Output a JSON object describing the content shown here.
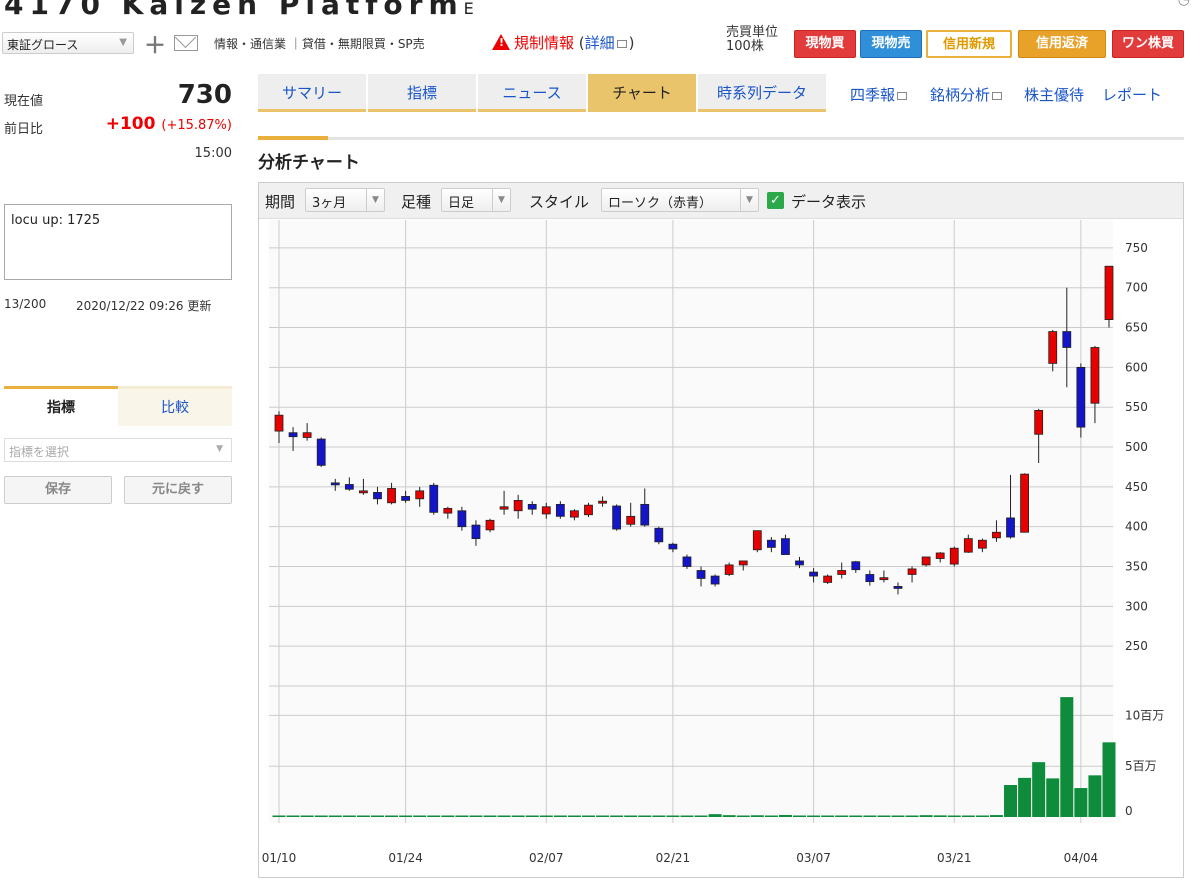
{
  "header": {
    "title": "4170 Kaizen Platform",
    "title_suffix": "E",
    "market": "東証グロース",
    "info": "情報・通信業 ｜貸借・無期限買・SP売",
    "regulation": "規制情報",
    "regulation_detail": "詳細",
    "unit_label": "売買単位",
    "unit_value": "100株",
    "buttons": [
      "現物買",
      "現物売",
      "信用新規",
      "信用返済",
      "ワン株買"
    ]
  },
  "quote": {
    "current_label": "現在値",
    "current_value": "730",
    "diff_label": "前日比",
    "diff_value": "+100",
    "diff_pct": "+15.87%",
    "time": "15:00"
  },
  "memo": {
    "text": "locu up: 1725",
    "count": "13/200",
    "updated": "2020/12/22 09:26 更新"
  },
  "indicator_panel": {
    "tabs": [
      "指標",
      "比較"
    ],
    "select_placeholder": "指標を選択",
    "save": "保存",
    "reset": "元に戻す"
  },
  "tabs": [
    "サマリー",
    "指標",
    "ニュース",
    "チャート",
    "時系列データ"
  ],
  "active_tab": "チャート",
  "link_tabs": [
    "四季報",
    "銘柄分析",
    "株主優待",
    "レポート"
  ],
  "section_title": "分析チャート",
  "toolbar": {
    "period_label": "期間",
    "period_value": "3ヶ月",
    "bar_label": "足種",
    "bar_value": "日足",
    "style_label": "スタイル",
    "style_value": "ローソク（赤青）",
    "data_display": "データ表示"
  },
  "colors": {
    "up": "#e60000",
    "down": "#1414c8",
    "volume": "#0e8c3c",
    "accent": "#e9b13b"
  },
  "chart_data": {
    "type": "candlestick",
    "y_ticks": [
      250,
      300,
      350,
      400,
      450,
      500,
      550,
      600,
      650,
      700,
      750
    ],
    "y_range": [
      205,
      775
    ],
    "volume_ticks": [
      {
        "v": 0,
        "label": "0"
      },
      {
        "v": 5,
        "label": "5百万"
      },
      {
        "v": 10,
        "label": "10百万"
      }
    ],
    "volume_unit": "百万",
    "volume_range": [
      0,
      12.5
    ],
    "x_tick_labels": [
      {
        "index": 0,
        "label": "01/10"
      },
      {
        "index": 9,
        "label": "01/24"
      },
      {
        "index": 19,
        "label": "02/07"
      },
      {
        "index": 28,
        "label": "02/21"
      },
      {
        "index": 38,
        "label": "03/07"
      },
      {
        "index": 48,
        "label": "03/21"
      },
      {
        "index": 57,
        "label": "04/04"
      }
    ],
    "candles": [
      {
        "o": 520,
        "h": 545,
        "l": 505,
        "c": 540,
        "v": 0.05
      },
      {
        "o": 518,
        "h": 525,
        "l": 495,
        "c": 513,
        "v": 0.05
      },
      {
        "o": 512,
        "h": 530,
        "l": 508,
        "c": 518,
        "v": 0.12
      },
      {
        "o": 510,
        "h": 512,
        "l": 475,
        "c": 477,
        "v": 0.06
      },
      {
        "o": 455,
        "h": 460,
        "l": 445,
        "c": 453,
        "v": 0.05
      },
      {
        "o": 453,
        "h": 462,
        "l": 445,
        "c": 447,
        "v": 0.04
      },
      {
        "o": 445,
        "h": 460,
        "l": 440,
        "c": 445,
        "v": 0.03
      },
      {
        "o": 443,
        "h": 450,
        "l": 428,
        "c": 435,
        "v": 0.03
      },
      {
        "o": 430,
        "h": 455,
        "l": 428,
        "c": 448,
        "v": 0.03
      },
      {
        "o": 438,
        "h": 445,
        "l": 430,
        "c": 433,
        "v": 0.03
      },
      {
        "o": 435,
        "h": 450,
        "l": 425,
        "c": 445,
        "v": 0.04
      },
      {
        "o": 452,
        "h": 455,
        "l": 415,
        "c": 418,
        "v": 0.03
      },
      {
        "o": 417,
        "h": 425,
        "l": 410,
        "c": 423,
        "v": 0.04
      },
      {
        "o": 420,
        "h": 425,
        "l": 395,
        "c": 400,
        "v": 0.03
      },
      {
        "o": 402,
        "h": 408,
        "l": 376,
        "c": 385,
        "v": 0.03
      },
      {
        "o": 396,
        "h": 410,
        "l": 393,
        "c": 408,
        "v": 0.03
      },
      {
        "o": 422,
        "h": 445,
        "l": 415,
        "c": 425,
        "v": 0.03
      },
      {
        "o": 420,
        "h": 440,
        "l": 410,
        "c": 433,
        "v": 0.04
      },
      {
        "o": 428,
        "h": 432,
        "l": 415,
        "c": 422,
        "v": 0.03
      },
      {
        "o": 416,
        "h": 430,
        "l": 410,
        "c": 425,
        "v": 0.03
      },
      {
        "o": 428,
        "h": 432,
        "l": 410,
        "c": 413,
        "v": 0.03
      },
      {
        "o": 412,
        "h": 422,
        "l": 408,
        "c": 420,
        "v": 0.04
      },
      {
        "o": 415,
        "h": 430,
        "l": 412,
        "c": 427,
        "v": 0.05
      },
      {
        "o": 430,
        "h": 438,
        "l": 425,
        "c": 432,
        "v": 0.04
      },
      {
        "o": 426,
        "h": 428,
        "l": 395,
        "c": 397,
        "v": 0.13
      },
      {
        "o": 403,
        "h": 430,
        "l": 400,
        "c": 413,
        "v": 0.05
      },
      {
        "o": 428,
        "h": 448,
        "l": 400,
        "c": 402,
        "v": 0.08
      },
      {
        "o": 398,
        "h": 400,
        "l": 378,
        "c": 381,
        "v": 0.07
      },
      {
        "o": 378,
        "h": 380,
        "l": 368,
        "c": 372,
        "v": 0.1
      },
      {
        "o": 362,
        "h": 365,
        "l": 347,
        "c": 350,
        "v": 0.08
      },
      {
        "o": 345,
        "h": 350,
        "l": 325,
        "c": 335,
        "v": 0.07
      },
      {
        "o": 338,
        "h": 340,
        "l": 325,
        "c": 328,
        "v": 0.28
      },
      {
        "o": 340,
        "h": 355,
        "l": 338,
        "c": 352,
        "v": 0.18
      },
      {
        "o": 352,
        "h": 357,
        "l": 345,
        "c": 357,
        "v": 0.12
      },
      {
        "o": 371,
        "h": 395,
        "l": 368,
        "c": 395,
        "v": 0.17
      },
      {
        "o": 383,
        "h": 387,
        "l": 368,
        "c": 374,
        "v": 0.12
      },
      {
        "o": 385,
        "h": 390,
        "l": 365,
        "c": 365,
        "v": 0.2
      },
      {
        "o": 357,
        "h": 362,
        "l": 348,
        "c": 352,
        "v": 0.07
      },
      {
        "o": 343,
        "h": 348,
        "l": 330,
        "c": 338,
        "v": 0.06
      },
      {
        "o": 330,
        "h": 340,
        "l": 328,
        "c": 338,
        "v": 0.06
      },
      {
        "o": 340,
        "h": 355,
        "l": 335,
        "c": 345,
        "v": 0.05
      },
      {
        "o": 356,
        "h": 357,
        "l": 342,
        "c": 346,
        "v": 0.04
      },
      {
        "o": 340,
        "h": 345,
        "l": 326,
        "c": 331,
        "v": 0.05
      },
      {
        "o": 335,
        "h": 345,
        "l": 330,
        "c": 336,
        "v": 0.03
      },
      {
        "o": 325,
        "h": 330,
        "l": 315,
        "c": 323,
        "v": 0.04
      },
      {
        "o": 340,
        "h": 350,
        "l": 330,
        "c": 347,
        "v": 0.05
      },
      {
        "o": 352,
        "h": 362,
        "l": 350,
        "c": 362,
        "v": 0.18
      },
      {
        "o": 360,
        "h": 368,
        "l": 355,
        "c": 367,
        "v": 0.16
      },
      {
        "o": 353,
        "h": 375,
        "l": 350,
        "c": 373,
        "v": 0.09
      },
      {
        "o": 368,
        "h": 390,
        "l": 367,
        "c": 385,
        "v": 0.11
      },
      {
        "o": 373,
        "h": 385,
        "l": 368,
        "c": 383,
        "v": 0.05
      },
      {
        "o": 386,
        "h": 408,
        "l": 381,
        "c": 393,
        "v": 0.19
      },
      {
        "o": 411,
        "h": 465,
        "l": 385,
        "c": 387,
        "v": 3.15
      },
      {
        "o": 393,
        "h": 467,
        "l": 393,
        "c": 466,
        "v": 3.85
      },
      {
        "o": 516,
        "h": 548,
        "l": 480,
        "c": 546,
        "v": 5.4
      },
      {
        "o": 605,
        "h": 647,
        "l": 595,
        "c": 645,
        "v": 3.8
      },
      {
        "o": 645,
        "h": 700,
        "l": 575,
        "c": 625,
        "v": 11.8
      },
      {
        "o": 600,
        "h": 605,
        "l": 512,
        "c": 525,
        "v": 2.85
      },
      {
        "o": 555,
        "h": 627,
        "l": 530,
        "c": 625,
        "v": 4.1
      },
      {
        "o": 660,
        "h": 727,
        "l": 650,
        "c": 727,
        "v": 7.35
      }
    ]
  }
}
